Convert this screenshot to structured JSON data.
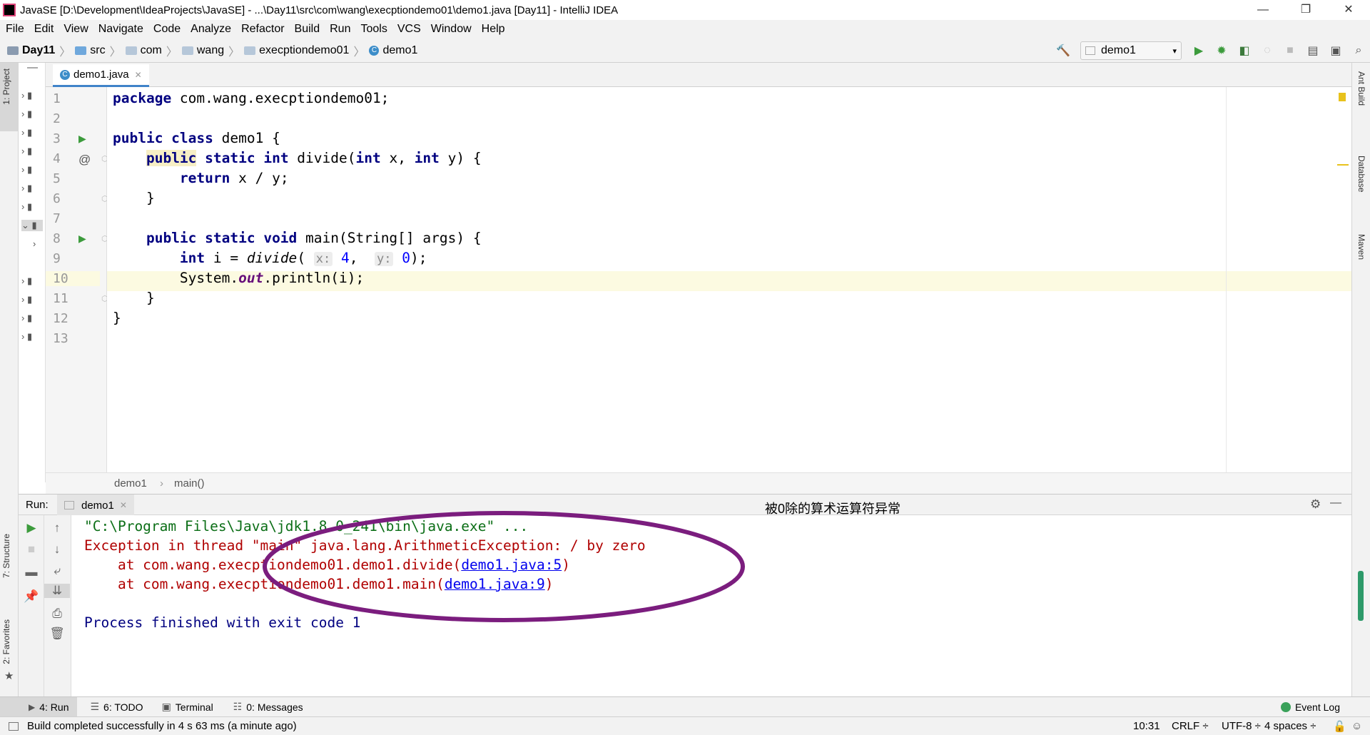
{
  "window": {
    "title": "JavaSE [D:\\Development\\IdeaProjects\\JavaSE] - ...\\Day11\\src\\com\\wang\\execptiondemo01\\demo1.java [Day11] - IntelliJ IDEA",
    "minimize": "—",
    "restore": "❐",
    "close": "✕"
  },
  "menu": [
    "File",
    "Edit",
    "View",
    "Navigate",
    "Code",
    "Analyze",
    "Refactor",
    "Build",
    "Run",
    "Tools",
    "VCS",
    "Window",
    "Help"
  ],
  "breadcrumbs": [
    "Day11",
    "src",
    "com",
    "wang",
    "execptiondemo01",
    "demo1"
  ],
  "run_config": "demo1",
  "left_tools": [
    "1: Project",
    "7: Structure",
    "2: Favorites"
  ],
  "right_tools": [
    "Ant Build",
    "Database",
    "Maven"
  ],
  "editor": {
    "tab": "demo1.java",
    "line_numbers": [
      "1",
      "2",
      "3",
      "4",
      "5",
      "6",
      "7",
      "8",
      "9",
      "10",
      "11",
      "12",
      "13"
    ],
    "code": {
      "l1_kw": "package",
      "l1_rest": " com.wang.execptiondemo01;",
      "l3_kw": "public class",
      "l3_rest": " demo1 {",
      "l4_indent": "    ",
      "l4_kw1": "public",
      "l4_kw2": " static int",
      "l4_mid": " divide(",
      "l4_kw3": "int",
      "l4_mid2": " x, ",
      "l4_kw4": "int",
      "l4_end": " y) {",
      "l5_indent": "        ",
      "l5_kw": "return",
      "l5_rest": " x / y;",
      "l6": "    }",
      "l8_indent": "    ",
      "l8_kw": "public static void",
      "l8_rest": " main(String[] args) {",
      "l9_indent": "        ",
      "l9_kw": "int",
      "l9_a": " i = ",
      "l9_fn": "divide",
      "l9_b": "( ",
      "l9_hint_x": "x:",
      "l9_v1": " 4",
      "l9_c": ",  ",
      "l9_hint_y": "y:",
      "l9_v2": " 0",
      "l9_end": ");",
      "l10_indent": "        ",
      "l10_a": "System.",
      "l10_field": "out",
      "l10_b": ".println(i);",
      "l11": "    }",
      "l12": "}"
    }
  },
  "code_breadcrumb": [
    "demo1",
    "main()"
  ],
  "run_panel": {
    "label": "Run:",
    "tab": "demo1",
    "annotation": "被0除的算术运算符异常",
    "console": {
      "cmd": "\"C:\\Program Files\\Java\\jdk1.8.0_241\\bin\\java.exe\" ...",
      "exception": "Exception in thread \"main\" java.lang.ArithmeticException: / by zero",
      "at1_prefix": "    at com.wang.execptiondemo01.demo1.divide(",
      "at1_link": "demo1.java:5",
      "at1_suffix": ")",
      "at2_prefix": "    at com.wang.execptiondemo01.demo1.main(",
      "at2_link": "demo1.java:9",
      "at2_suffix": ")",
      "finished": "Process finished with exit code 1"
    }
  },
  "bottom_tabs": [
    "4: Run",
    "6: TODO",
    "Terminal",
    "0: Messages"
  ],
  "event_log": "Event Log",
  "status": {
    "message": "Build completed successfully in 4 s 63 ms (a minute ago)",
    "position": "10:31",
    "line_sep": "CRLF ÷",
    "encoding": "UTF-8 ÷",
    "indent": "4 spaces ÷"
  },
  "colors": {
    "annotation_ellipse": "#7b1d7e",
    "annotation_text": "#e0201b",
    "console_error": "#b00000",
    "console_info": "#000080"
  }
}
